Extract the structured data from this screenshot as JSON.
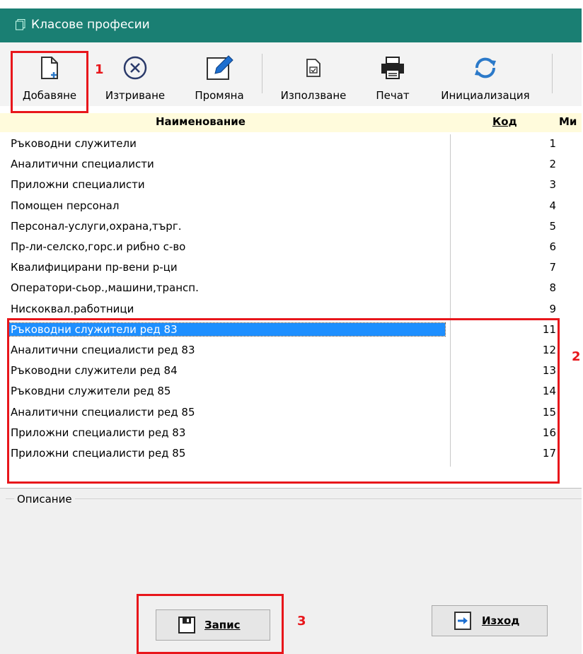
{
  "window": {
    "title": "Класове професии"
  },
  "toolbar": {
    "add": "Добавяне",
    "delete": "Изтриване",
    "edit": "Промяна",
    "use": "Използване",
    "print": "Печат",
    "init": "Инициализация"
  },
  "table": {
    "col_name": "Наименование",
    "col_code": "Код",
    "col_more": "Ми",
    "rows": [
      {
        "name": "Ръководни служители",
        "code": "1"
      },
      {
        "name": "Аналитични специалисти",
        "code": "2"
      },
      {
        "name": "Приложни специалисти",
        "code": "3"
      },
      {
        "name": "Помощен персонал",
        "code": "4"
      },
      {
        "name": "Персонал-услуги,охрана,търг.",
        "code": "5"
      },
      {
        "name": "Пр-ли-селско,горс.и рибно с-во",
        "code": "6"
      },
      {
        "name": "Квалифицирани пр-вени р-ци",
        "code": "7"
      },
      {
        "name": "Оператори-сьор.,машини,трансп.",
        "code": "8"
      },
      {
        "name": "Нискоквал.работници",
        "code": "9"
      },
      {
        "name": "Ръководни служители ред 83",
        "code": "11"
      },
      {
        "name": "Аналитични специалисти ред 83",
        "code": "12"
      },
      {
        "name": "Ръководни служители ред 84",
        "code": "13"
      },
      {
        "name": "Ръковдни служители ред 85",
        "code": "14"
      },
      {
        "name": "Аналитични специалисти ред 85",
        "code": "15"
      },
      {
        "name": "Приложни специалисти ред 83",
        "code": "16"
      },
      {
        "name": "Приложни специалисти ред 85",
        "code": "17"
      }
    ]
  },
  "description": {
    "label": "Описание"
  },
  "buttons": {
    "save": "Запис",
    "exit": "Изход"
  },
  "annotations": {
    "n1": "1",
    "n2": "2",
    "n3": "3"
  },
  "colors": {
    "title_bar": "#1a7f73",
    "header_bg": "#fffbdc",
    "selection": "#1e8fff",
    "annotation_red": "#e8161b"
  }
}
